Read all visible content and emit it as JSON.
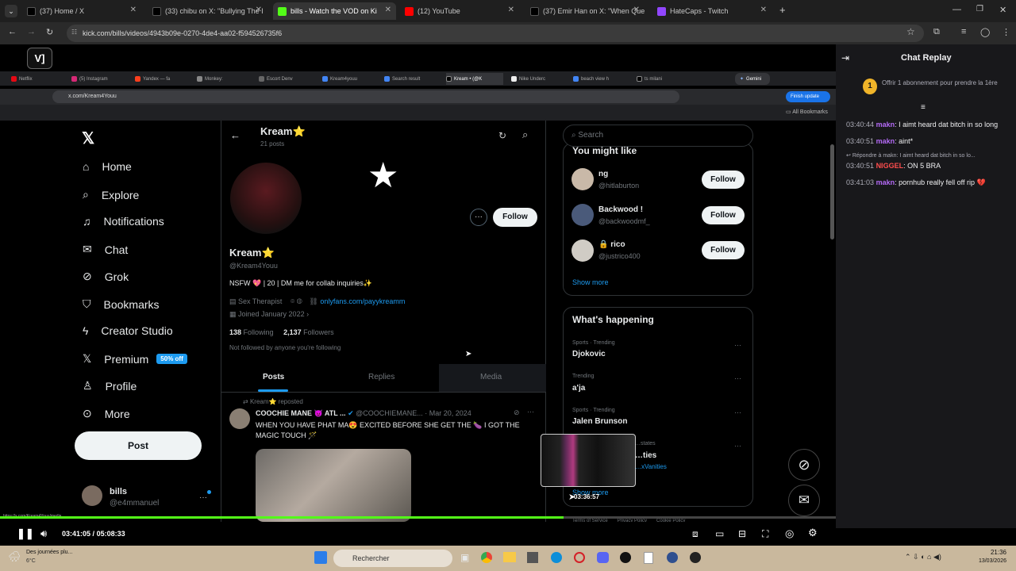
{
  "browser": {
    "tabs": [
      {
        "label": "(37) Home / X",
        "color": "#000"
      },
      {
        "label": "(33) chibu on X: \"Bullying The I",
        "color": "#000"
      },
      {
        "label": "bills - Watch the VOD on Ki",
        "color": "#53fc18"
      },
      {
        "label": "(12) YouTube",
        "color": "#ff0000"
      },
      {
        "label": "(37) Emir Han on X: \"When Que",
        "color": "#000"
      },
      {
        "label": "HateCaps - Twitch",
        "color": "#9146ff"
      }
    ],
    "url": "kick.com/bills/videos/4943b09e-0270-4de4-aa02-f594526735f6"
  },
  "inner": {
    "tabs": [
      "Netflix",
      "(5) Instagram",
      "Yandex — fa",
      "Monkey:",
      "Escort Denv",
      "Kream4youu",
      "Search result",
      "Kream • (@K",
      "Nike Underc",
      "beach view h",
      "ts milani"
    ],
    "gemini": "Gemini",
    "url": "x.com/Kream4Youu",
    "finish": "Finish update",
    "all_bookmarks": "All Bookmarks"
  },
  "x": {
    "nav": [
      "Home",
      "Explore",
      "Notifications",
      "Chat",
      "Grok",
      "Bookmarks",
      "Creator Studio",
      "Premium",
      "Profile",
      "More"
    ],
    "premium_badge": "50% off",
    "post_label": "Post",
    "account": {
      "name": "bills",
      "handle": "@e4mmanuel"
    },
    "header": {
      "name": "Kream⭐",
      "posts": "21 posts"
    },
    "profile": {
      "name": "Kream⭐",
      "handle": "@Kream4Youu",
      "bio": "NSFW 💖 | 20 | DM me for collab inquiries✨",
      "category": "Sex Therapist",
      "link": "onlyfans.com/payykreamm",
      "joined": "Joined January 2022",
      "following_count": "138",
      "following_label": "Following",
      "followers_count": "2,137",
      "followers_label": "Followers",
      "not_followed": "Not followed by anyone you're following",
      "follow_label": "Follow"
    },
    "tabs": [
      "Posts",
      "Replies",
      "Media"
    ],
    "tweet": {
      "reposted": "Kream⭐ reposted",
      "author": "COOCHIE MANE 😈 ATL ...",
      "handle": "@COOCHIEMANE...",
      "date": "· Mar 20, 2024",
      "text": "WHEN YOU HAVE PHAT MA😍 EXCITED BEFORE SHE GET THE 🍆 I GOT THE MAGIC TOUCH 🪄"
    },
    "search_placeholder": "Search",
    "you_might_like": "You might like",
    "suggestions": [
      {
        "name": "ng",
        "handle": "@hitlaburton"
      },
      {
        "name": "Backwood !",
        "handle": "@backwoodmf_"
      },
      {
        "name": "rico",
        "handle": "@justrico400"
      }
    ],
    "show_more": "Show more",
    "happening_title": "What's happening",
    "trends": [
      {
        "meta": "Sports · Trending",
        "name": "Djokovic"
      },
      {
        "meta": "Trending",
        "name": "a'ja"
      },
      {
        "meta": "Sports · Trending",
        "name": "Jalen Brunson"
      },
      {
        "meta": "…states",
        "name": "…ties",
        "sub": "…xVanities"
      }
    ],
    "footer_links": [
      "Terms of Service",
      "Privacy Policy",
      "Cookie Policy"
    ]
  },
  "player": {
    "time_current": "03:41:05",
    "time_sep": "/",
    "time_total": "05:08:33",
    "progress": 0.674,
    "preview_time": "03:36:57",
    "status_url": "https://x.com/Kream4Youu/media"
  },
  "chat": {
    "title": "Chat Replay",
    "pinned": "Offrir 1 abonnement pour prendre la 1ère",
    "messages": [
      {
        "time": "03:40:44",
        "user": "makn",
        "color": "#b46af6",
        "text": "I aimt heard dat bitch in so long"
      },
      {
        "time": "03:40:51",
        "user": "makn",
        "color": "#b46af6",
        "text": "aint*"
      },
      {
        "reply": "Répondre à makn: I aimt heard dat bitch in so lo..."
      },
      {
        "time": "03:40:51",
        "user": "NIGGEL",
        "color": "#ff4d4d",
        "text": "ON 5 BRA"
      },
      {
        "time": "03:41:03",
        "user": "makn",
        "color": "#b46af6",
        "text": "pornhub really fell off rip 💔"
      }
    ]
  },
  "taskbar": {
    "weather": "Des journées plu...",
    "temp": "6°C",
    "search": "Rechercher",
    "clock_time": "21:36",
    "clock_date": "13/03/2026"
  }
}
